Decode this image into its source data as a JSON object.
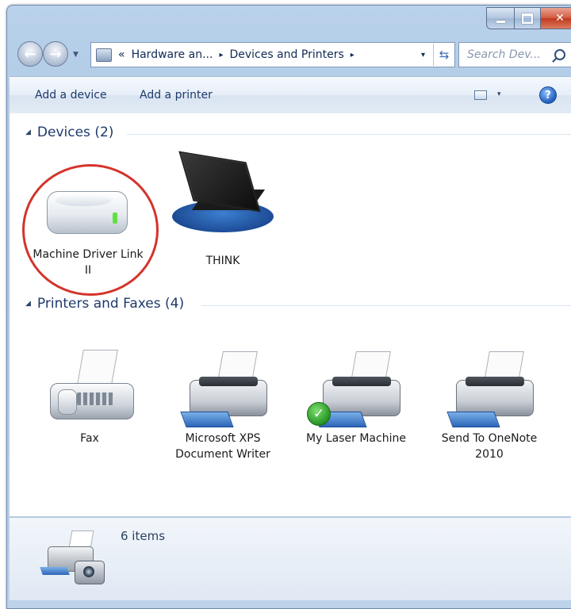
{
  "window": {
    "nav": {
      "back_icon": "back-arrow-icon",
      "forward_icon": "forward-arrow-icon"
    },
    "address": {
      "overflow": "«",
      "crumb1": "Hardware an...",
      "sep1": "▸",
      "crumb2": "Devices and Printers",
      "sep2": "▸",
      "dropdown": "▾",
      "refresh": "⇆"
    },
    "search": {
      "placeholder": "Search Dev..."
    }
  },
  "commandbar": {
    "add_device": "Add a device",
    "add_printer": "Add a printer",
    "view_dropdown": "▾",
    "help": "?"
  },
  "groups": {
    "devices": {
      "title": "Devices (2)",
      "items": [
        {
          "label": "Machine Driver Link II",
          "icon": "hard-drive-icon",
          "highlighted": true
        },
        {
          "label": "THINK",
          "icon": "laptop-icon"
        }
      ]
    },
    "printers": {
      "title": "Printers and Faxes (4)",
      "items": [
        {
          "label": "Fax",
          "icon": "fax-icon"
        },
        {
          "label": "Microsoft XPS Document Writer",
          "icon": "printer-icon"
        },
        {
          "label": "My Laser Machine",
          "icon": "printer-icon",
          "default": true
        },
        {
          "label": "Send To OneNote 2010",
          "icon": "printer-icon"
        }
      ]
    }
  },
  "details": {
    "count": "6 items"
  },
  "colors": {
    "highlight_ring": "#d3342b",
    "link_text": "#1e3a6b",
    "default_check": "#1f8f1f"
  }
}
